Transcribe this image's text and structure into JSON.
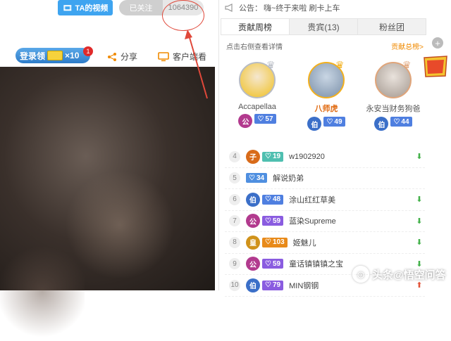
{
  "header": {
    "video_button": "TA的视频",
    "follow_button": "已关注",
    "follower_count": "1064390"
  },
  "actions": {
    "login_badge": "登录领",
    "login_multiplier": "×10",
    "notification_count": "1",
    "share": "分享",
    "client": "客户端看"
  },
  "panel": {
    "notice_label": "公告：",
    "notice_text": "嗨~终于来啦 刷卡上车",
    "tabs": [
      {
        "label": "贡献周榜",
        "active": true
      },
      {
        "label": "贵宾(13)",
        "active": false
      },
      {
        "label": "粉丝团",
        "active": false
      }
    ],
    "tip": "点击右侧查看详情",
    "tip_link": "贡献总榜>",
    "podium": [
      {
        "name": "Accapellaa",
        "noble": "公",
        "noble_color": "#b23a8e",
        "level": "57",
        "level_color": "#4f7fe0",
        "crown": "silver"
      },
      {
        "name": "八师虎",
        "noble": "伯",
        "noble_color": "#3b6fc8",
        "level": "49",
        "level_color": "#4f7fe0",
        "crown": "gold"
      },
      {
        "name": "永安当财务狗爸",
        "noble": "伯",
        "noble_color": "#3b6fc8",
        "level": "44",
        "level_color": "#4f7fe0",
        "crown": "bronze"
      }
    ],
    "list": [
      {
        "rank": "4",
        "noble": "子",
        "noble_color": "#d86b1a",
        "level": "19",
        "level_color": "#4fbfb0",
        "name": "w1902920",
        "trend": "down"
      },
      {
        "rank": "5",
        "noble": "",
        "noble_color": "",
        "level": "34",
        "level_color": "#4f8fe0",
        "name": "解说奶弟",
        "trend": "none"
      },
      {
        "rank": "6",
        "noble": "伯",
        "noble_color": "#3b6fc8",
        "level": "48",
        "level_color": "#4f7fe0",
        "name": "涂山红红草美",
        "trend": "down"
      },
      {
        "rank": "7",
        "noble": "公",
        "noble_color": "#b23a8e",
        "level": "59",
        "level_color": "#8a5ce0",
        "name": "蓝染Supreme",
        "trend": "down"
      },
      {
        "rank": "8",
        "noble": "皇",
        "noble_color": "#d0921a",
        "level": "103",
        "level_color": "#e88a1a",
        "name": "姬魅儿",
        "trend": "down"
      },
      {
        "rank": "9",
        "noble": "公",
        "noble_color": "#b23a8e",
        "level": "59",
        "level_color": "#8a5ce0",
        "name": "童话镇镇镇之宝",
        "trend": "down"
      },
      {
        "rank": "10",
        "noble": "伯",
        "noble_color": "#3b6fc8",
        "level": "79",
        "level_color": "#8a5ce0",
        "name": "MIN钢钢",
        "trend": "up"
      }
    ]
  },
  "side": {
    "plus": "+",
    "event_logo": "猜奇英雄"
  },
  "watermark": "头条@悟空问答",
  "colors": {
    "accent_blue": "#3ea4f0",
    "accent_orange": "#f08a00",
    "trend_down": "#43b14a",
    "trend_up": "#e2543a",
    "annotation_red": "#e0483a"
  }
}
